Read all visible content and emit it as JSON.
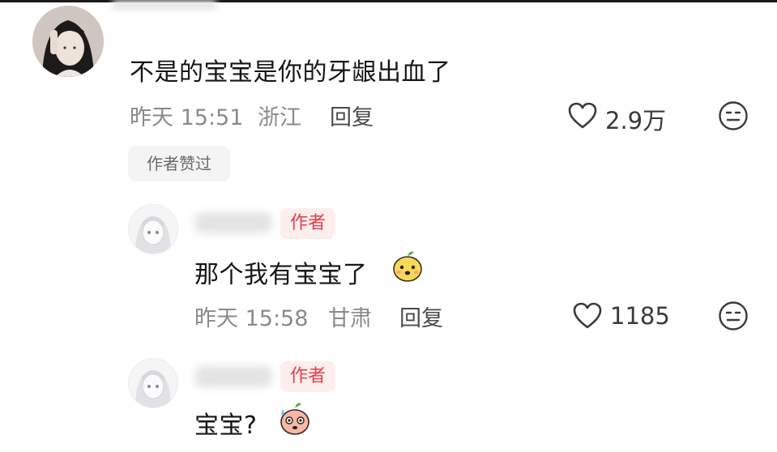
{
  "comments": [
    {
      "text": "不是的宝宝是你的牙龈出血了",
      "time": "昨天 15:51",
      "location": "浙江",
      "reply_label": "回复",
      "likes": "2.9万",
      "author_liked_label": "作者赞过"
    }
  ],
  "replies": [
    {
      "badge": "作者",
      "text": "那个我有宝宝了",
      "emoji": "mango-face",
      "time": "昨天 15:58",
      "location": "甘肃",
      "reply_label": "回复",
      "likes": "1185"
    },
    {
      "badge": "作者",
      "text": "宝宝?",
      "emoji": "sweating-face"
    }
  ],
  "icons": {
    "like": "heart-outline-icon",
    "dislike": "meh-face-icon"
  },
  "colors": {
    "badge_text": "#e0414e",
    "badge_bg": "#fdeeee",
    "meta_text": "#8a8a8a"
  }
}
